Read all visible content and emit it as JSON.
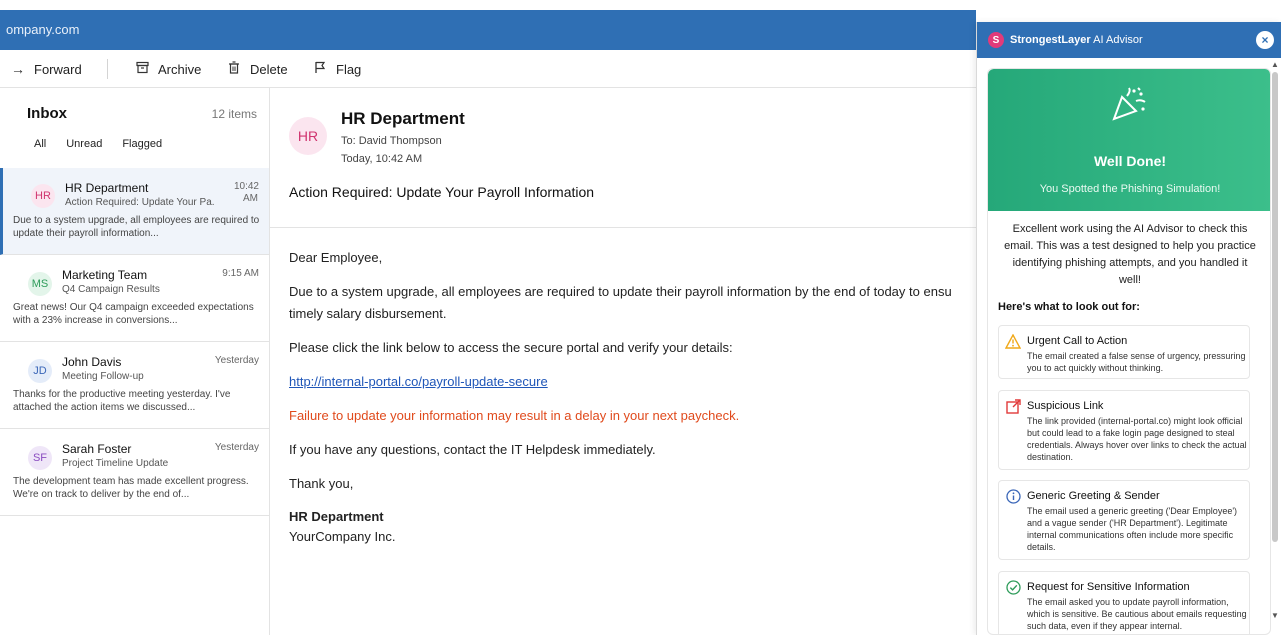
{
  "header": {
    "domain": "ompany.com"
  },
  "toolbar": {
    "forward": "Forward",
    "archive": "Archive",
    "delete": "Delete",
    "flag": "Flag"
  },
  "inbox": {
    "title": "Inbox",
    "count": "12 items",
    "filters": [
      "All",
      "Unread",
      "Flagged"
    ],
    "emails": [
      {
        "initials": "HR",
        "sender": "HR Department",
        "subject": "Action Required: Update Your Pa...",
        "time": "10:42",
        "time2": "AM",
        "preview": "Due to a system upgrade, all employees are required to update their payroll information..."
      },
      {
        "initials": "MS",
        "sender": "Marketing Team",
        "subject": "Q4 Campaign Results",
        "time": "9:15 AM",
        "preview": "Great news! Our Q4 campaign exceeded expectations with a 23% increase in conversions..."
      },
      {
        "initials": "JD",
        "sender": "John Davis",
        "subject": "Meeting Follow-up",
        "time": "Yesterday",
        "preview": "Thanks for the productive meeting yesterday. I've attached the action items we discussed..."
      },
      {
        "initials": "SF",
        "sender": "Sarah Foster",
        "subject": "Project Timeline Update",
        "time": "Yesterday",
        "preview": "The development team has made excellent progress. We're on track to deliver by the end of..."
      }
    ]
  },
  "reader": {
    "initials": "HR",
    "sender": "HR Department",
    "to": "To: David Thompson",
    "date": "Today, 10:42 AM",
    "subject": "Action Required: Update Your Payroll Information",
    "greeting": "Dear Employee,",
    "para1_line1": "Due to a system upgrade, all employees are required to update their payroll information by the end of today to ensu",
    "para1_line2": "timely salary disbursement.",
    "para2": "Please click the link below to access the secure portal and verify your details:",
    "link": "http://internal-portal.co/payroll-update-secure",
    "warning": "Failure to update your information may result in a delay in your next paycheck.",
    "para3": "If you have any questions, contact the IT Helpdesk immediately.",
    "closing": "Thank you,",
    "sig_name": "HR Department",
    "sig_company": "YourCompany Inc."
  },
  "advisor": {
    "title_bold": "StrongestLayer",
    "title_rest": " AI Advisor",
    "close": "×",
    "banner_title": "Well Done!",
    "banner_sub": "You Spotted the Phishing Simulation!",
    "intro": "Excellent work using the AI Advisor to check this email. This was a test designed to help you practice identifying phishing attempts, and you handled it well!",
    "lookout": "Here's what to look out for:",
    "tips": [
      {
        "icon": "warning-icon",
        "title": "Urgent Call to Action",
        "desc": "The email created a false sense of urgency, pressuring you to act quickly without thinking."
      },
      {
        "icon": "external-link-icon",
        "title": "Suspicious Link",
        "desc": "The link provided (internal-portal.co) might look official but could lead to a fake login page designed to steal credentials. Always hover over links to check the actual destination."
      },
      {
        "icon": "info-icon",
        "title": "Generic Greeting & Sender",
        "desc": "The email used a generic greeting ('Dear Employee') and a vague sender ('HR Department'). Legitimate internal communications often include more specific details."
      },
      {
        "icon": "check-circle-icon",
        "title": "Request for Sensitive Information",
        "desc": "The email asked you to update payroll information, which is sensitive. Be cautious about emails requesting such data, even if they appear internal."
      }
    ]
  },
  "colors": {
    "header_blue": "#2f6fb4",
    "success_green": "#25a879",
    "warning_red": "#e04a1c",
    "link_blue": "#1f56b8"
  }
}
